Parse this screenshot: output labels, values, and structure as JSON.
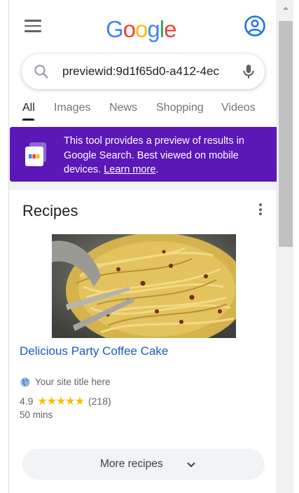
{
  "header": {
    "logo_letters": [
      "G",
      "o",
      "o",
      "g",
      "l",
      "e"
    ],
    "menu_icon": "hamburger-menu-icon",
    "account_icon": "account-circle-icon"
  },
  "search": {
    "value": "previewid:9d1f65d0-a412-4ec",
    "search_icon": "search-icon",
    "mic_icon": "mic-icon"
  },
  "tabs": [
    {
      "label": "All",
      "active": true
    },
    {
      "label": "Images",
      "active": false
    },
    {
      "label": "News",
      "active": false
    },
    {
      "label": "Shopping",
      "active": false
    },
    {
      "label": "Videos",
      "active": false
    }
  ],
  "banner": {
    "text": "This tool provides a preview of results in Google Search. Best viewed on mobile devices.",
    "link": "Learn more",
    "trailing": ".",
    "background": "#5b17b8"
  },
  "card": {
    "title": "Recipes",
    "recipe_title": "Delicious Party Coffee Cake",
    "site_name": "Your site title here",
    "rating": "4.9",
    "stars": "★★★★★",
    "review_count": "(218)",
    "duration": "50 mins",
    "more_label": "More recipes"
  },
  "colors": {
    "link": "#1a5bc4",
    "star": "#fbbc04"
  }
}
